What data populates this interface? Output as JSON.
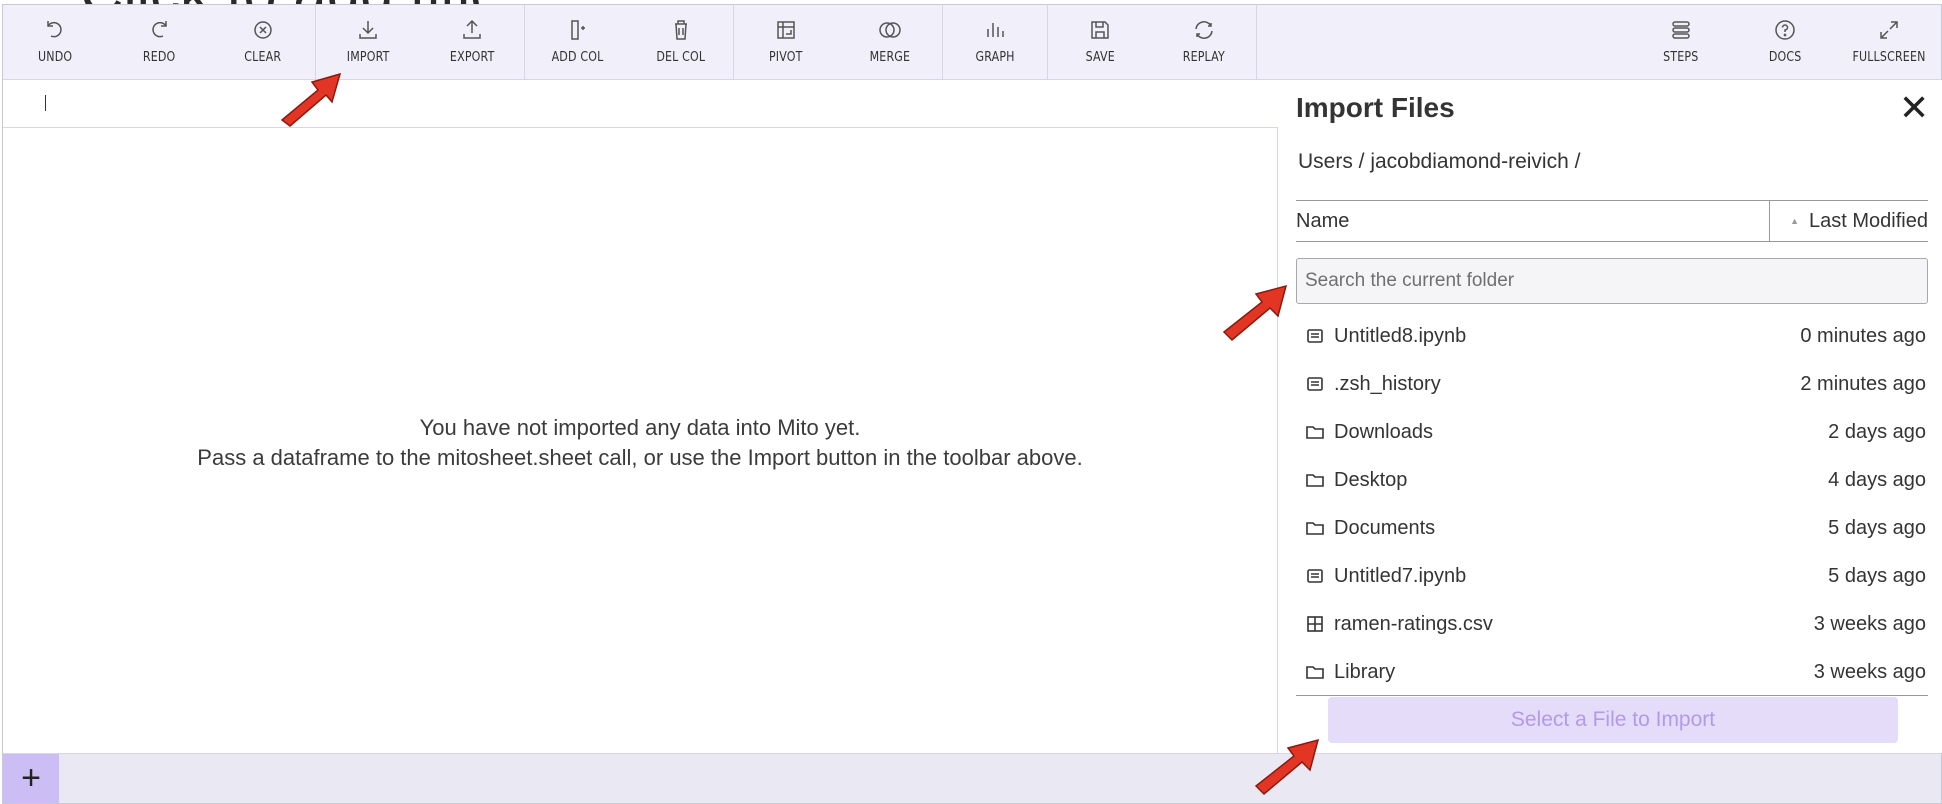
{
  "ghost_title": "Click to add title",
  "toolbar": {
    "left": [
      {
        "label": "UNDO",
        "icon": "undo-icon"
      },
      {
        "label": "REDO",
        "icon": "redo-icon"
      },
      {
        "label": "CLEAR",
        "icon": "clear-icon"
      },
      {
        "label": "IMPORT",
        "icon": "import-icon"
      },
      {
        "label": "EXPORT",
        "icon": "export-icon"
      },
      {
        "label": "ADD COL",
        "icon": "add-col-icon"
      },
      {
        "label": "DEL COL",
        "icon": "del-col-icon"
      },
      {
        "label": "PIVOT",
        "icon": "pivot-icon"
      },
      {
        "label": "MERGE",
        "icon": "merge-icon"
      },
      {
        "label": "GRAPH",
        "icon": "graph-icon"
      },
      {
        "label": "SAVE",
        "icon": "save-icon"
      },
      {
        "label": "REPLAY",
        "icon": "replay-icon"
      }
    ],
    "right": [
      {
        "label": "STEPS",
        "icon": "steps-icon"
      },
      {
        "label": "DOCS",
        "icon": "docs-icon"
      },
      {
        "label": "FULLSCREEN",
        "icon": "fullscreen-icon"
      }
    ]
  },
  "sheet": {
    "empty_line1": "You have not imported any data into Mito yet.",
    "empty_line2": "Pass a dataframe to the mitosheet.sheet call, or use the Import button in the toolbar above."
  },
  "footer": {
    "add_label": "+"
  },
  "import_panel": {
    "title": "Import Files",
    "close": "✕",
    "breadcrumb": "Users / jacobdiamond-reivich /",
    "col_name": "Name",
    "col_modified": "Last Modified",
    "search_placeholder": "Search the current folder",
    "files": [
      {
        "name": "Untitled8.ipynb",
        "modified": "0 minutes ago",
        "type": "file"
      },
      {
        "name": ".zsh_history",
        "modified": "2 minutes ago",
        "type": "file"
      },
      {
        "name": "Downloads",
        "modified": "2 days ago",
        "type": "folder"
      },
      {
        "name": "Desktop",
        "modified": "4 days ago",
        "type": "folder"
      },
      {
        "name": "Documents",
        "modified": "5 days ago",
        "type": "folder"
      },
      {
        "name": "Untitled7.ipynb",
        "modified": "5 days ago",
        "type": "file"
      },
      {
        "name": "ramen-ratings.csv",
        "modified": "3 weeks ago",
        "type": "csv"
      },
      {
        "name": "Library",
        "modified": "3 weeks ago",
        "type": "folder"
      }
    ],
    "import_button": "Select a File to Import",
    "accent_color": "#cdbdf5"
  }
}
